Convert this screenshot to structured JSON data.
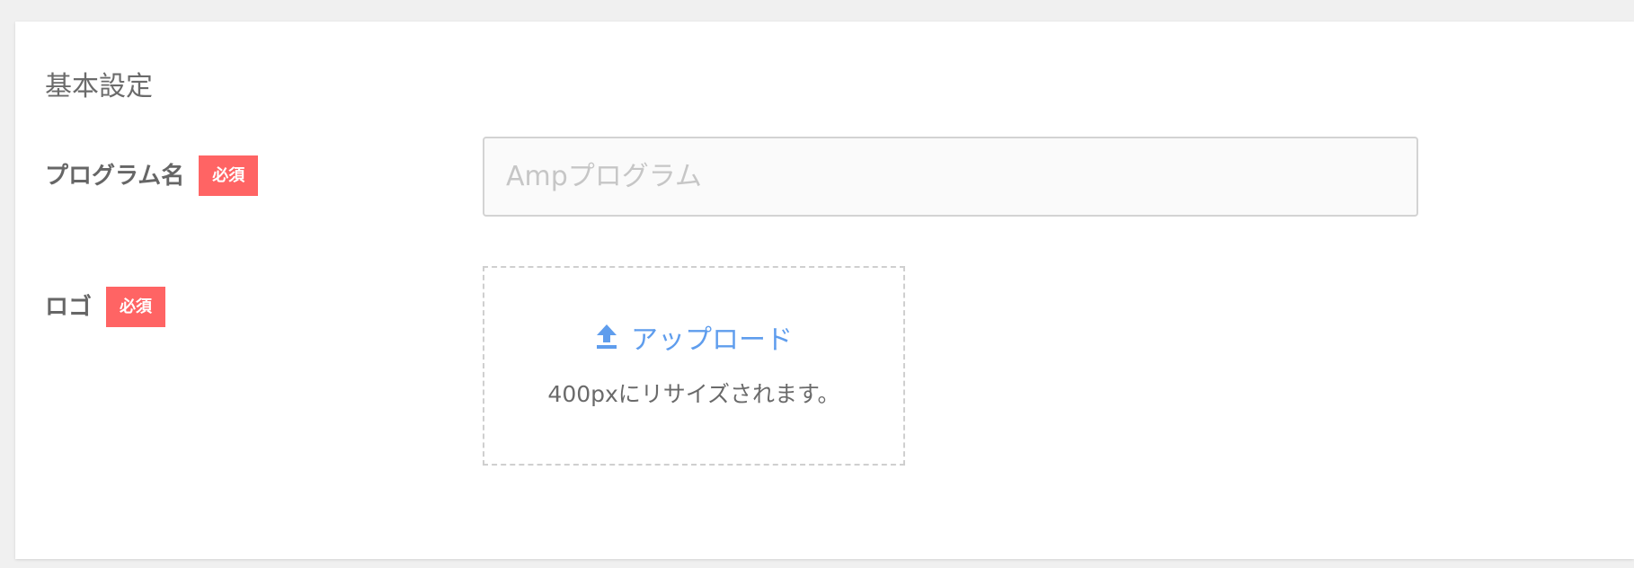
{
  "section": {
    "title": "基本設定"
  },
  "fields": {
    "program_name": {
      "label": "プログラム名",
      "required_badge": "必須",
      "placeholder": "Ampプログラム",
      "value": ""
    },
    "logo": {
      "label": "ロゴ",
      "required_badge": "必須",
      "upload_label": "アップロード",
      "hint": "400pxにリサイズされます。"
    }
  },
  "icons": {
    "upload": "upload-arrow-icon"
  },
  "colors": {
    "badge_bg": "#ff6464",
    "link": "#5f9ded",
    "text": "#666666",
    "page_bg": "#f0f0f0"
  }
}
